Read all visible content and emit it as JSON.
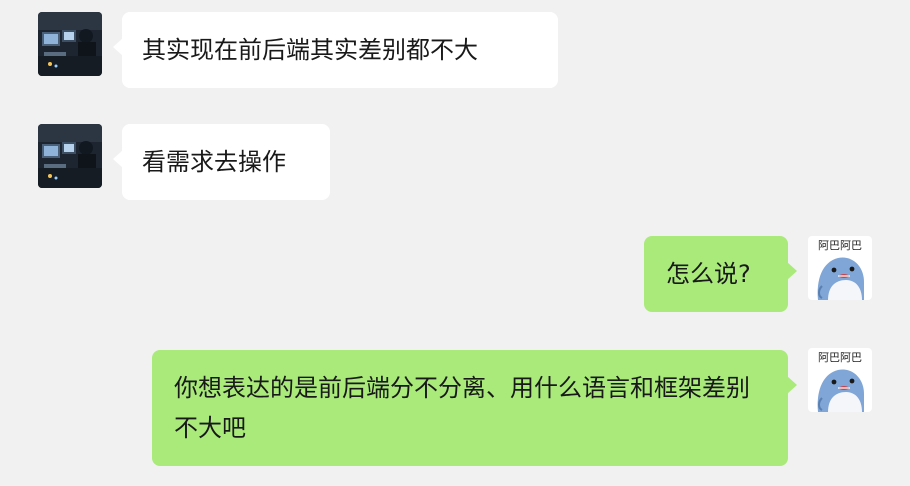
{
  "messages": [
    {
      "side": "left",
      "avatar": "contact-desk-photo",
      "text": "其实现在前后端其实差别都不大"
    },
    {
      "side": "left",
      "avatar": "contact-desk-photo",
      "text": "看需求去操作"
    },
    {
      "side": "right",
      "avatar": "self-dolphin-sticker",
      "text": "怎么说?"
    },
    {
      "side": "right",
      "avatar": "self-dolphin-sticker",
      "text": "你想表达的是前后端分不分离、用什么语言和框架差别不大吧"
    }
  ],
  "self_avatar_caption": "阿巴阿巴",
  "colors": {
    "background": "#f1f1f1",
    "incoming_bubble": "#ffffff",
    "outgoing_bubble": "#a9ea7a",
    "text": "#191919"
  }
}
